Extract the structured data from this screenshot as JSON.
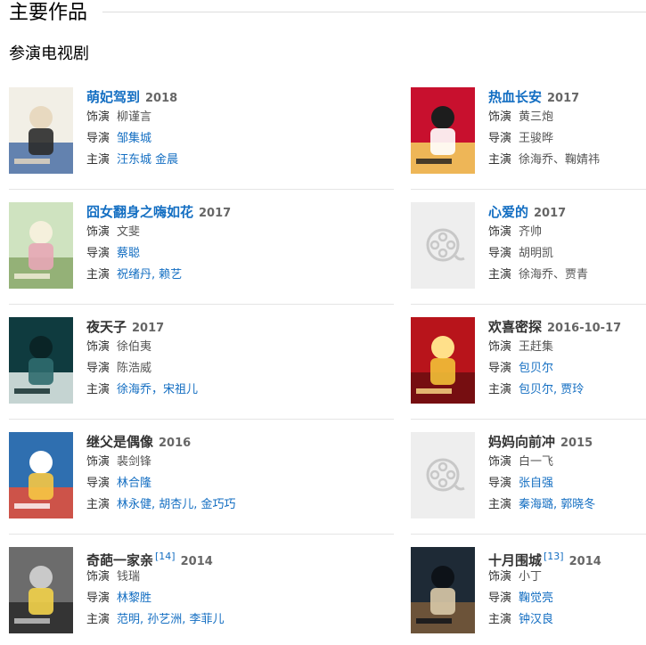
{
  "section_title": "主要作品",
  "subsection_title": "参演电视剧",
  "role_labels": {
    "role": "饰演",
    "director": "导演",
    "starring": "主演"
  },
  "works": [
    {
      "title": "萌妃驾到",
      "ref": "",
      "year": "2018",
      "title_is_link": true,
      "role": "柳谨言",
      "director": "邹集城",
      "director_is_link": true,
      "starring": "汪东城 金晨",
      "starring_is_link": true,
      "poster": "poster"
    },
    {
      "title": "热血长安",
      "ref": "",
      "year": "2017",
      "title_is_link": true,
      "role": "黄三炮",
      "director": "王骏晔",
      "director_is_link": false,
      "starring": "徐海乔、鞠婧祎",
      "starring_is_link": false,
      "poster": "poster"
    },
    {
      "title": "囧女翻身之嗨如花",
      "ref": "",
      "year": "2017",
      "title_is_link": true,
      "role": "文斐",
      "director": "蔡聪",
      "director_is_link": true,
      "starring": "祝绪丹, 赖艺",
      "starring_is_link": true,
      "poster": "poster"
    },
    {
      "title": "心爱的",
      "ref": "",
      "year": "2017",
      "title_is_link": true,
      "role": "齐帅",
      "director": "胡明凯",
      "director_is_link": false,
      "starring": "徐海乔、贾青",
      "starring_is_link": false,
      "poster": "film-reel-icon"
    },
    {
      "title": "夜天子",
      "ref": "",
      "year": "2017",
      "title_is_link": false,
      "role": "徐伯夷",
      "director": "陈浩威",
      "director_is_link": false,
      "starring": "徐海乔，宋祖儿",
      "starring_is_link": true,
      "poster": "poster"
    },
    {
      "title": "欢喜密探",
      "ref": "",
      "year": "2016-10-17",
      "title_is_link": false,
      "role": "王赶集",
      "director": "包贝尔",
      "director_is_link": true,
      "starring": "包贝尔, 贾玲",
      "starring_is_link": true,
      "poster": "poster"
    },
    {
      "title": "继父是偶像",
      "ref": "",
      "year": "2016",
      "title_is_link": false,
      "role": "裴剑锋",
      "director": "林合隆",
      "director_is_link": true,
      "starring": "林永健, 胡杏儿, 金巧巧",
      "starring_is_link": true,
      "poster": "poster"
    },
    {
      "title": "妈妈向前冲",
      "ref": "",
      "year": "2015",
      "title_is_link": false,
      "role": "白一飞",
      "director": "张自强",
      "director_is_link": true,
      "starring": "秦海璐, 郭晓冬",
      "starring_is_link": true,
      "poster": "film-reel-icon"
    },
    {
      "title": "奇葩一家亲",
      "ref": "[14]",
      "year": "2014",
      "title_is_link": false,
      "role": "钱瑞",
      "director": "林黎胜",
      "director_is_link": true,
      "starring": "范明, 孙艺洲, 李菲儿",
      "starring_is_link": true,
      "poster": "poster"
    },
    {
      "title": "十月围城",
      "ref": "[13]",
      "year": "2014",
      "title_is_link": false,
      "role": "小丁",
      "director": "鞠觉亮",
      "director_is_link": true,
      "starring": "钟汉良",
      "starring_is_link": true,
      "poster": "poster"
    }
  ],
  "colors": {
    "link": "#136ec2",
    "year": "#666666",
    "separator": "#e5e5e5",
    "placeholder_bg": "#eeeeee",
    "placeholder_icon": "#c8c8c8"
  }
}
